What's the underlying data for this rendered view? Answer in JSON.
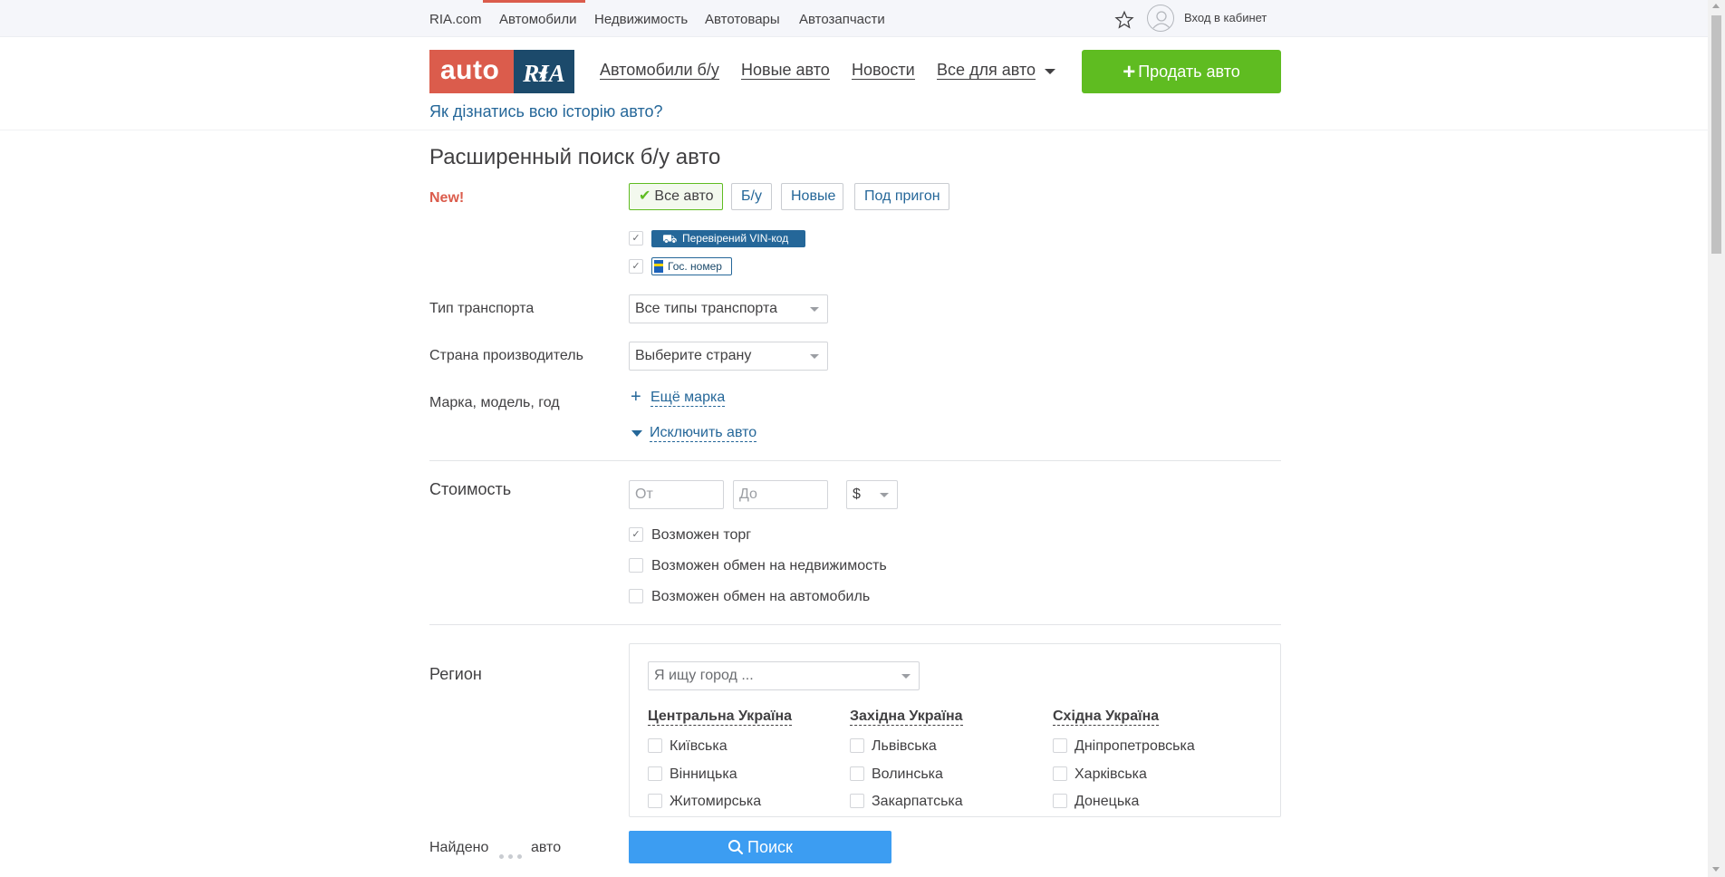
{
  "topbar": {
    "links": [
      "RIA.com",
      "Автомобили",
      "Недвижимость",
      "Автотовары",
      "Автозапчасти"
    ],
    "active_link": "Автомобили",
    "login": "Вход в кабинет"
  },
  "header": {
    "logo_auto": "auto",
    "logo_ria": "RIA",
    "nav": [
      "Автомобили б/у",
      "Новые авто",
      "Новости",
      "Все для авто"
    ],
    "sell_button": "Продать авто",
    "history_link": "Як дізнатись всю історію авто?"
  },
  "form": {
    "title": "Расширенный поиск б/у авто",
    "new_label": "New!",
    "tabs": [
      "Все авто",
      "Б/у",
      "Новые",
      "Под пригон"
    ],
    "active_tab": "Все авто",
    "vin_badge": "Перевірений VIN-код",
    "plate_badge": "Гос. номер",
    "transport_label": "Тип транспорта",
    "transport_value": "Все типы транспорта",
    "country_label": "Страна производитель",
    "country_value": "Выберите страну",
    "brand_label": "Марка, модель, год",
    "add_brand": "Ещё марка",
    "exclude": "Исключить авто",
    "price_label": "Стоимость",
    "price_from_placeholder": "От",
    "price_to_placeholder": "До",
    "currency": "$",
    "checkboxes": [
      {
        "label": "Возможен торг",
        "checked": true
      },
      {
        "label": "Возможен обмен на недвижимость",
        "checked": false
      },
      {
        "label": "Возможен обмен на автомобиль",
        "checked": false
      }
    ],
    "region_label": "Регион",
    "city_placeholder": "Я ищу город ...",
    "regions": [
      {
        "name": "Центральна Україна",
        "items": [
          "Київська",
          "Вінницька",
          "Житомирська"
        ]
      },
      {
        "name": "Західна Україна",
        "items": [
          "Львівська",
          "Волинська",
          "Закарпатська"
        ]
      },
      {
        "name": "Східна Україна",
        "items": [
          "Дніпропетровська",
          "Харківська",
          "Донецька"
        ]
      }
    ]
  },
  "bottom": {
    "found": "Найдено",
    "found_suffix": "авто",
    "search_button": "Поиск"
  },
  "colors": {
    "brand_red": "#db5c4c",
    "brand_navy": "#1c4a6b",
    "link_blue": "#256799",
    "green": "#5fbc21",
    "search_blue": "#3c9df2"
  }
}
